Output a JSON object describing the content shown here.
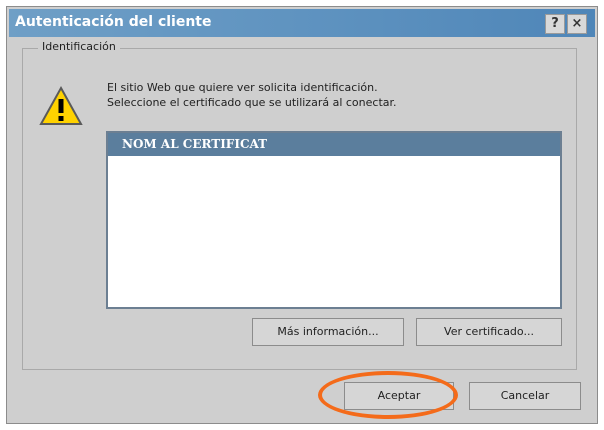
{
  "window": {
    "title": "Autenticación del cliente",
    "help_label": "?",
    "close_label": "×"
  },
  "group": {
    "label": "Identificación"
  },
  "icon": {
    "warning": "warning-icon"
  },
  "message": {
    "line1": "El sitio Web que quiere ver solicita identificación.",
    "line2": "Seleccione el certificado que se utilizará al conectar."
  },
  "list": {
    "column_header": "NOM AL CERTIFICAT"
  },
  "buttons": {
    "more_info": "Más información...",
    "view_certificate": "Ver certificado...",
    "accept": "Aceptar",
    "cancel": "Cancelar"
  },
  "colors": {
    "titlebar": "#5f93c0",
    "highlight": "#f46b1a",
    "list_header": "#5b7e9d"
  }
}
